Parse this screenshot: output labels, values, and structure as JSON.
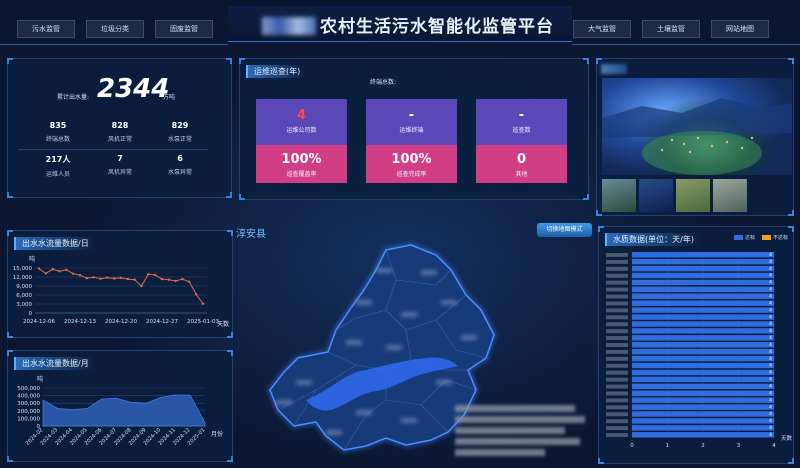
{
  "header": {
    "title": "农村生活污水智能化监管平台",
    "left_nav": [
      "污水监管",
      "垃圾分类",
      "固废监管"
    ],
    "right_nav": [
      "大气监管",
      "土壤监管",
      "网站地图"
    ]
  },
  "stats": {
    "total_label": "累计出水量:",
    "total_value": "2344",
    "total_unit": "万吨",
    "items": [
      {
        "value": "835",
        "label": "终端总数"
      },
      {
        "value": "828",
        "label": "风机正常"
      },
      {
        "value": "829",
        "label": "水泵正常"
      },
      {
        "value": "217人",
        "label": "运维人员"
      },
      {
        "value": "7",
        "label": "风机异常"
      },
      {
        "value": "6",
        "label": "水泵异常"
      }
    ]
  },
  "ops": {
    "title": "运维巡查(年)",
    "subtitle": "终端总数:",
    "cards_top": [
      {
        "value": "4",
        "label": "运维公司数"
      },
      {
        "value": "-",
        "label": "运维终端"
      },
      {
        "value": "-",
        "label": "巡查数"
      }
    ],
    "cards_bottom": [
      {
        "value": "100%",
        "label": "巡查覆盖率"
      },
      {
        "value": "100%",
        "label": "巡查完成率"
      },
      {
        "value": "0",
        "label": "其他"
      }
    ]
  },
  "map": {
    "county_label": "淳安县",
    "switch_button": "切换地图模式"
  },
  "colors": {
    "accent": "#3f7fe0",
    "card_top": "#5a48b8",
    "card_bottom": "#d23e86",
    "line": "#e36b4a",
    "bar_ok": "#2f6ce0",
    "bar_bad": "#f0a020"
  },
  "daily_chart": {
    "title": "出水水流量数据/日",
    "chart_data": {
      "type": "line",
      "ylabel": "吨",
      "xlabel": "天数",
      "ylim": [
        0,
        15000
      ],
      "yticks": [
        "0",
        "3,000",
        "6,000",
        "9,000",
        "12,000",
        "15,000"
      ],
      "xticks": [
        "2024-12-06",
        "2024-12-13",
        "2024-12-20",
        "2024-12-27",
        "2025-01-03"
      ],
      "values": [
        14800,
        13200,
        14600,
        13900,
        14400,
        13100,
        12600,
        11600,
        11900,
        11400,
        11800,
        11500,
        11700,
        11300,
        11100,
        9000,
        12900,
        12700,
        11300,
        11100,
        10700,
        11300,
        10400,
        6200,
        3100
      ]
    }
  },
  "monthly_chart": {
    "title": "出水水流量数据/月",
    "chart_data": {
      "type": "area",
      "ylabel": "吨",
      "xlabel": "月份",
      "ylim": [
        0,
        500000
      ],
      "yticks": [
        "0",
        "100,000",
        "200,000",
        "300,000",
        "400,000",
        "500,000"
      ],
      "categories": [
        "2024-02",
        "2024-03",
        "2024-04",
        "2024-05",
        "2024-06",
        "2024-07",
        "2024-08",
        "2024-09",
        "2024-10",
        "2024-11",
        "2024-12",
        "2025-01"
      ],
      "values": [
        340000,
        230000,
        215000,
        230000,
        355000,
        365000,
        310000,
        300000,
        375000,
        410000,
        405000,
        40000
      ]
    }
  },
  "water_quality": {
    "title": "水质数据(单位：天/年)",
    "legend_ok": "达标",
    "legend_bad": "不达标",
    "chart_data": {
      "type": "bar",
      "xlabel": "天数",
      "xlim": [
        0,
        4
      ],
      "xticks": [
        "0",
        "1",
        "2",
        "3",
        "4"
      ],
      "values": [
        4,
        4,
        4,
        4,
        4,
        4,
        4,
        4,
        4,
        4,
        4,
        4,
        4,
        4,
        4,
        4,
        4,
        4,
        4,
        4,
        4,
        4,
        4,
        4,
        4,
        4,
        4
      ],
      "data_labels": [
        "4",
        "4",
        "4",
        "4",
        "4",
        "4",
        "4",
        "4",
        "4",
        "4",
        "4",
        "4",
        "4",
        "4",
        "4",
        "4",
        "4",
        "4",
        "4",
        "4",
        "4",
        "4",
        "4",
        "4",
        "4",
        "4",
        "4"
      ]
    }
  }
}
